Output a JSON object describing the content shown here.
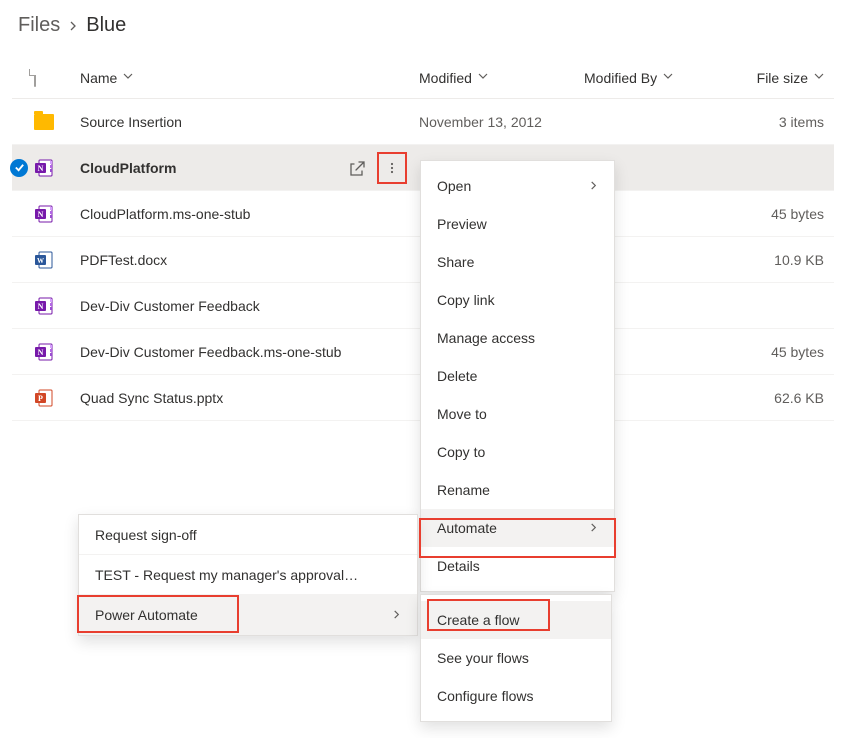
{
  "breadcrumb": {
    "root": "Files",
    "current": "Blue"
  },
  "columns": {
    "name": "Name",
    "modified": "Modified",
    "modifiedBy": "Modified By",
    "fileSize": "File size"
  },
  "rows": [
    {
      "name": "Source Insertion",
      "icon": "folder",
      "modified": "November 13, 2012",
      "size": "3 items",
      "selected": false
    },
    {
      "name": "CloudPlatform",
      "icon": "onenote",
      "modified": "",
      "size": "",
      "selected": true,
      "bold": true,
      "actions": true
    },
    {
      "name": "CloudPlatform.ms-one-stub",
      "icon": "onenote",
      "modified": "",
      "size": "45 bytes",
      "selected": false
    },
    {
      "name": "PDFTest.docx",
      "icon": "word",
      "modified": "",
      "size": "10.9 KB",
      "selected": false
    },
    {
      "name": "Dev-Div Customer Feedback",
      "icon": "onenote",
      "modified": "",
      "size": "",
      "selected": false
    },
    {
      "name": "Dev-Div Customer Feedback.ms-one-stub",
      "icon": "onenote",
      "modified": "",
      "size": "45 bytes",
      "selected": false
    },
    {
      "name": "Quad Sync Status.pptx",
      "icon": "powerpoint",
      "modified": "",
      "size": "62.6 KB",
      "selected": false
    }
  ],
  "contextMenu": {
    "items": [
      {
        "id": "open",
        "label": "Open",
        "sub": true
      },
      {
        "id": "preview",
        "label": "Preview"
      },
      {
        "id": "share",
        "label": "Share"
      },
      {
        "id": "copylink",
        "label": "Copy link"
      },
      {
        "id": "manage",
        "label": "Manage access"
      },
      {
        "id": "delete",
        "label": "Delete"
      },
      {
        "id": "moveto",
        "label": "Move to"
      },
      {
        "id": "copyto",
        "label": "Copy to"
      },
      {
        "id": "rename",
        "label": "Rename"
      },
      {
        "id": "automate",
        "label": "Automate",
        "sub": true,
        "hover": true
      },
      {
        "id": "details",
        "label": "Details"
      }
    ]
  },
  "flowsMenu": {
    "items": [
      {
        "id": "signoff",
        "label": "Request sign-off"
      },
      {
        "id": "test",
        "label": "TEST - Request my manager's approval…"
      },
      {
        "id": "pa",
        "label": "Power Automate",
        "sub": true,
        "hover": true
      }
    ]
  },
  "paSubMenu": {
    "items": [
      {
        "id": "create",
        "label": "Create a flow",
        "hover": true
      },
      {
        "id": "see",
        "label": "See your flows"
      },
      {
        "id": "configure",
        "label": "Configure flows"
      }
    ]
  }
}
